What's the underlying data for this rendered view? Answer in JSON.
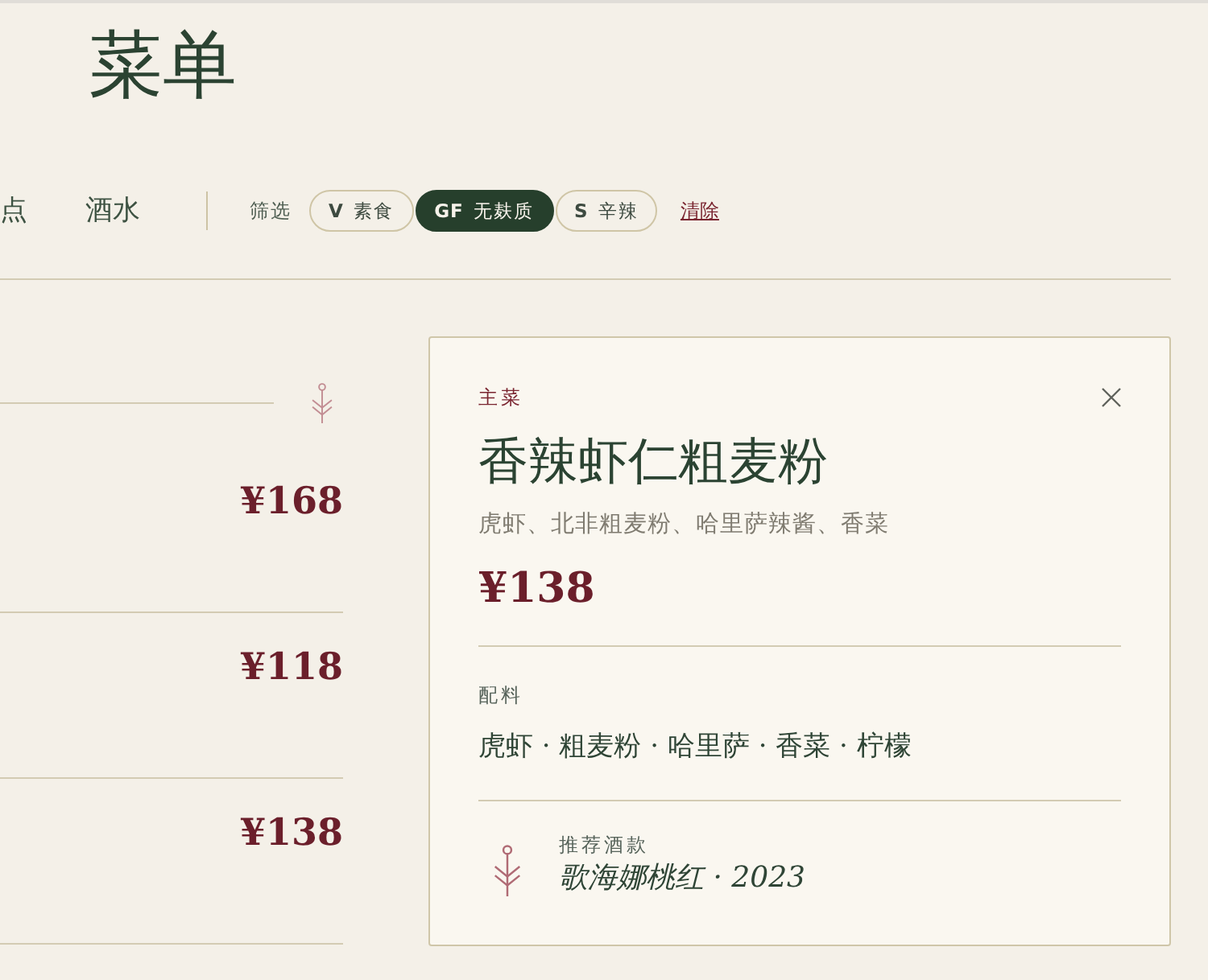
{
  "page": {
    "title": "菜单"
  },
  "tabs": [
    {
      "label": "点",
      "selected": false
    },
    {
      "label": "酒水",
      "selected": false
    }
  ],
  "filters": {
    "label": "筛选",
    "chips": [
      {
        "code": "V",
        "label": "素食",
        "selected": false
      },
      {
        "code": "GF",
        "label": "无麸质",
        "selected": true
      },
      {
        "code": "S",
        "label": "辛辣",
        "selected": false
      }
    ],
    "clear": "清除"
  },
  "menu": {
    "items": [
      {
        "price": "¥168"
      },
      {
        "price": "¥118"
      },
      {
        "price": "¥138"
      }
    ]
  },
  "detail": {
    "category": "主菜",
    "title": "香辣虾仁粗麦粉",
    "description": "虎虾、北非粗麦粉、哈里萨辣酱、香菜",
    "price": "¥138",
    "ingredients_label": "配料",
    "ingredients": "虎虾 · 粗麦粉 · 哈里萨 · 香菜 · 柠檬",
    "pairing_label": "推荐酒款",
    "pairing": "歌海娜桃红 · 2023"
  }
}
